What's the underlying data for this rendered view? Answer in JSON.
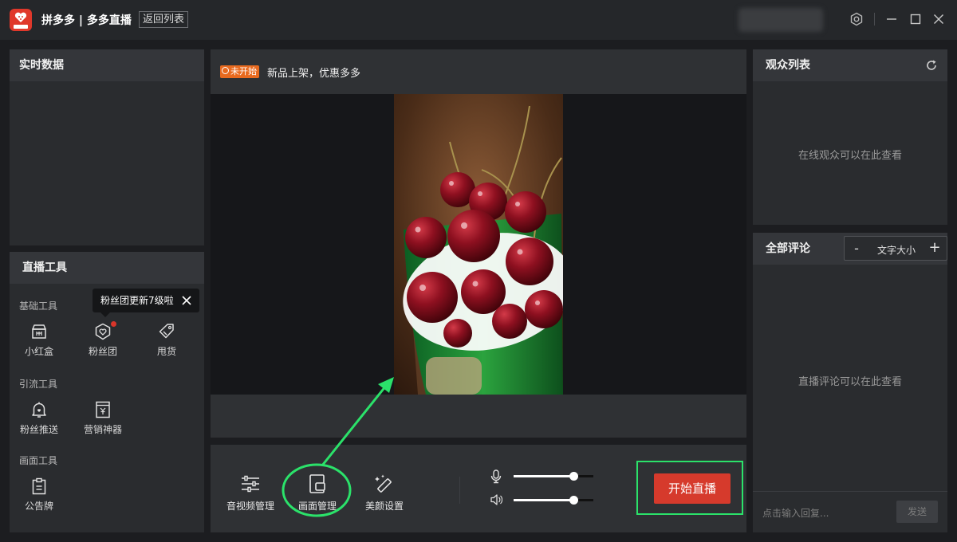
{
  "window": {
    "app_title": "拼多多 | 多多直播",
    "back_button": "返回列表"
  },
  "realtime": {
    "title": "实时数据"
  },
  "tools": {
    "title": "直播工具",
    "sections": [
      "基础工具",
      "引流工具",
      "画面工具"
    ],
    "basic": [
      "小红盒",
      "粉丝团",
      "甩货"
    ],
    "traffic": [
      "粉丝推送",
      "营销神器"
    ],
    "screen": [
      "公告牌"
    ],
    "tooltip": "粉丝团更新7级啦"
  },
  "notice": {
    "status": "未开始",
    "text": "新品上架，优惠多多"
  },
  "controls": {
    "buttons": [
      "音视频管理",
      "画面管理",
      "美颜设置"
    ],
    "mic_level": 0.76,
    "speaker_level": 0.76,
    "start_button": "开始直播"
  },
  "audience": {
    "title": "观众列表",
    "placeholder": "在线观众可以在此查看"
  },
  "comments": {
    "title": "全部评论",
    "font_minus": "-",
    "font_label": "文字大小",
    "font_plus": "+",
    "placeholder": "直播评论可以在此查看",
    "reply_placeholder": "点击输入回复...",
    "send": "发送"
  },
  "colors": {
    "accent_red": "#d63a2c",
    "annotation_green": "#2be26a",
    "status_orange": "#e86a1f"
  }
}
